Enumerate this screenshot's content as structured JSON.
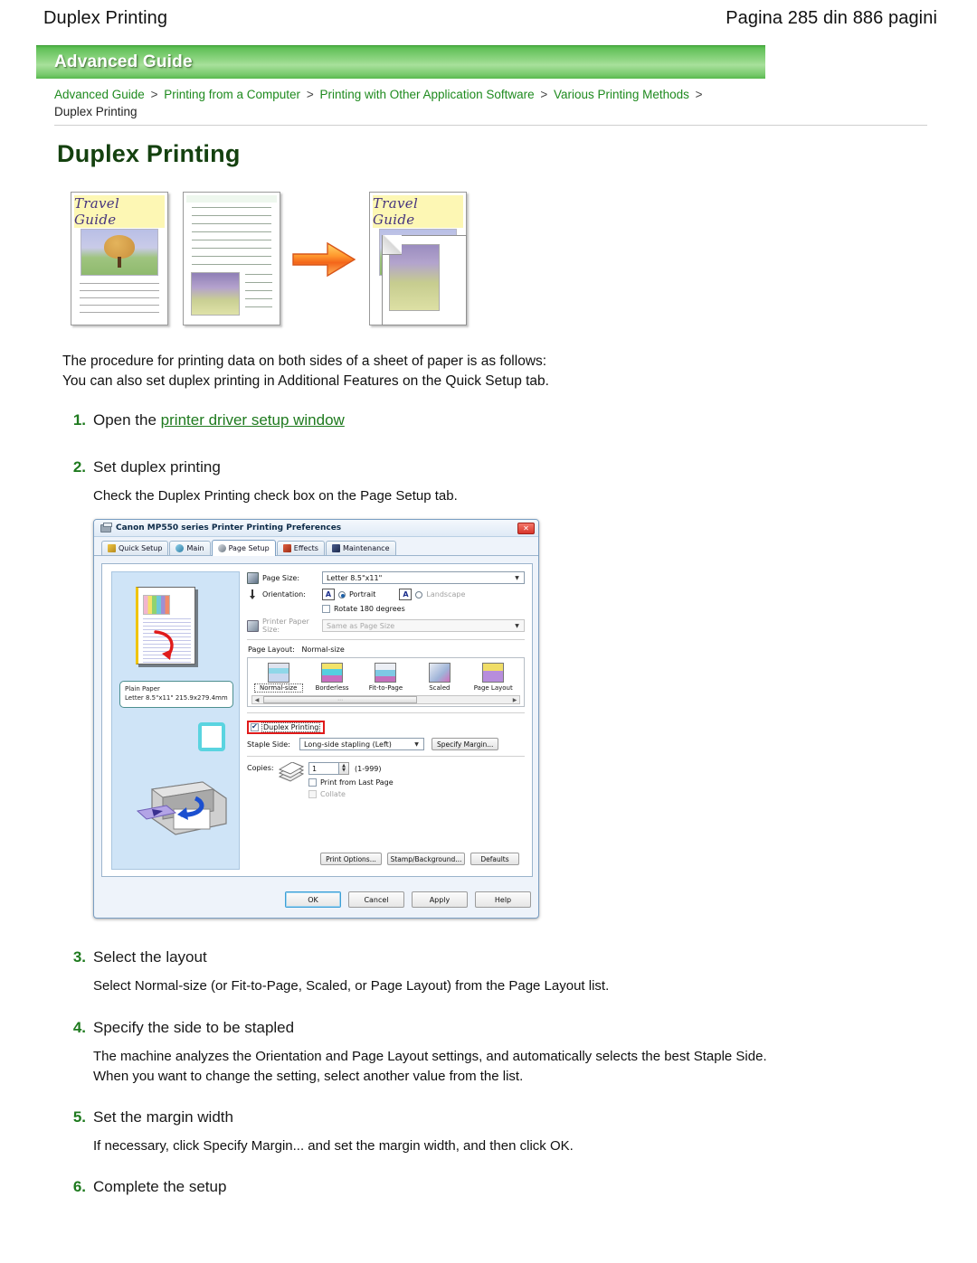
{
  "page_header": {
    "title": "Duplex Printing",
    "page_indicator": "Pagina 285 din 886 pagini"
  },
  "banner": {
    "label": "Advanced Guide"
  },
  "breadcrumb": {
    "items": [
      "Advanced Guide",
      "Printing from a Computer",
      "Printing with Other Application Software",
      "Various Printing Methods"
    ],
    "separator": ">",
    "current": "Duplex Printing"
  },
  "main_title": "Duplex Printing",
  "illustration": {
    "doc1_caption": "Travel Guide",
    "doc3_caption": "Travel Guide",
    "arrow": "right-arrow"
  },
  "intro": {
    "line1": "The procedure for printing data on both sides of a sheet of paper is as follows:",
    "line2": "You can also set duplex printing in Additional Features on the Quick Setup tab."
  },
  "steps": [
    {
      "num": "1.",
      "head_prefix": "Open the ",
      "head_link": "printer driver setup window",
      "sub": ""
    },
    {
      "num": "2.",
      "head": "Set duplex printing",
      "sub": "Check the Duplex Printing check box on the Page Setup tab."
    },
    {
      "num": "3.",
      "head": "Select the layout",
      "sub": "Select Normal-size (or Fit-to-Page, Scaled, or Page Layout) from the Page Layout list."
    },
    {
      "num": "4.",
      "head": "Specify the side to be stapled",
      "sub": "The machine analyzes the Orientation and Page Layout settings, and automatically selects the best Staple Side. When you want to change the setting, select another value from the list."
    },
    {
      "num": "5.",
      "head": "Set the margin width",
      "sub": "If necessary, click Specify Margin... and set the margin width, and then click OK."
    },
    {
      "num": "6.",
      "head": "Complete the setup",
      "sub": ""
    }
  ],
  "dialog": {
    "title": "Canon MP550 series Printer Printing Preferences",
    "close_label": "✕",
    "tabs": [
      {
        "label": "Quick Setup",
        "active": false
      },
      {
        "label": "Main",
        "active": false
      },
      {
        "label": "Page Setup",
        "active": true
      },
      {
        "label": "Effects",
        "active": false
      },
      {
        "label": "Maintenance",
        "active": false
      }
    ],
    "preview": {
      "info_line1": "Plain Paper",
      "info_line2": "Letter 8.5\"x11\" 215.9x279.4mm"
    },
    "page_size": {
      "label": "Page Size:",
      "value": "Letter 8.5\"x11\""
    },
    "orientation": {
      "label": "Orientation:",
      "portrait": "Portrait",
      "landscape": "Landscape",
      "portrait_selected": true,
      "glyph": "A",
      "rotate": "Rotate 180 degrees",
      "rotate_checked": false
    },
    "printer_paper_size": {
      "label": "Printer Paper Size:",
      "value": "Same as Page Size",
      "disabled": true
    },
    "page_layout": {
      "label": "Page Layout:",
      "value": "Normal-size",
      "options": [
        "Normal-size",
        "Borderless",
        "Fit-to-Page",
        "Scaled",
        "Page Layout"
      ],
      "selected_index": 0
    },
    "duplex": {
      "label": "Duplex Printing",
      "checked": true,
      "highlighted": true
    },
    "staple_side": {
      "label": "Staple Side:",
      "value": "Long-side stapling (Left)",
      "button": "Specify Margin..."
    },
    "copies": {
      "label": "Copies:",
      "value": "1",
      "range": "(1-999)",
      "print_last_page": "Print from Last Page",
      "print_last_page_checked": false,
      "collate": "Collate",
      "collate_checked": false,
      "collate_disabled": true
    },
    "action_buttons": [
      "Print Options...",
      "Stamp/Background...",
      "Defaults"
    ],
    "footer_buttons": [
      {
        "label": "OK",
        "default": true
      },
      {
        "label": "Cancel",
        "default": false
      },
      {
        "label": "Apply",
        "default": false
      },
      {
        "label": "Help",
        "default": false
      }
    ]
  },
  "colors": {
    "banner_green": "#63c15a",
    "link_green": "#1e8a1e",
    "heading_green": "#14410f",
    "highlight_red": "#e01b1b",
    "preview_blue": "#cfe4f7"
  }
}
